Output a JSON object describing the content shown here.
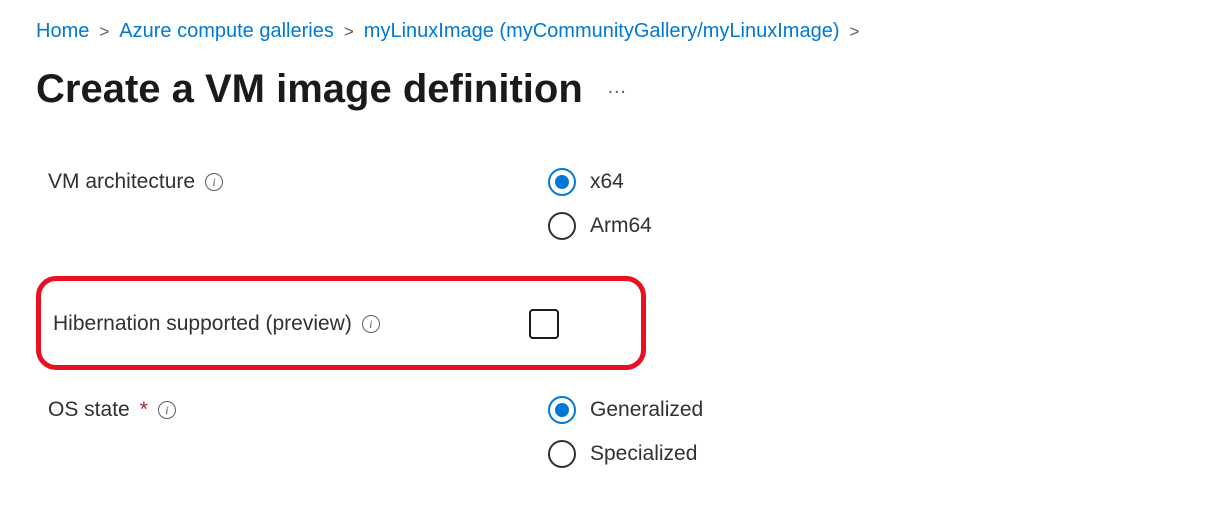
{
  "breadcrumb": {
    "home": "Home",
    "galleries": "Azure compute galleries",
    "image": "myLinuxImage (myCommunityGallery/myLinuxImage)"
  },
  "page": {
    "title": "Create a VM image definition",
    "more": "…"
  },
  "form": {
    "arch": {
      "label": "VM architecture",
      "options": {
        "x64": "x64",
        "arm64": "Arm64"
      }
    },
    "hibernation": {
      "label": "Hibernation supported (preview)"
    },
    "osstate": {
      "label": "OS state",
      "options": {
        "generalized": "Generalized",
        "specialized": "Specialized"
      }
    }
  }
}
